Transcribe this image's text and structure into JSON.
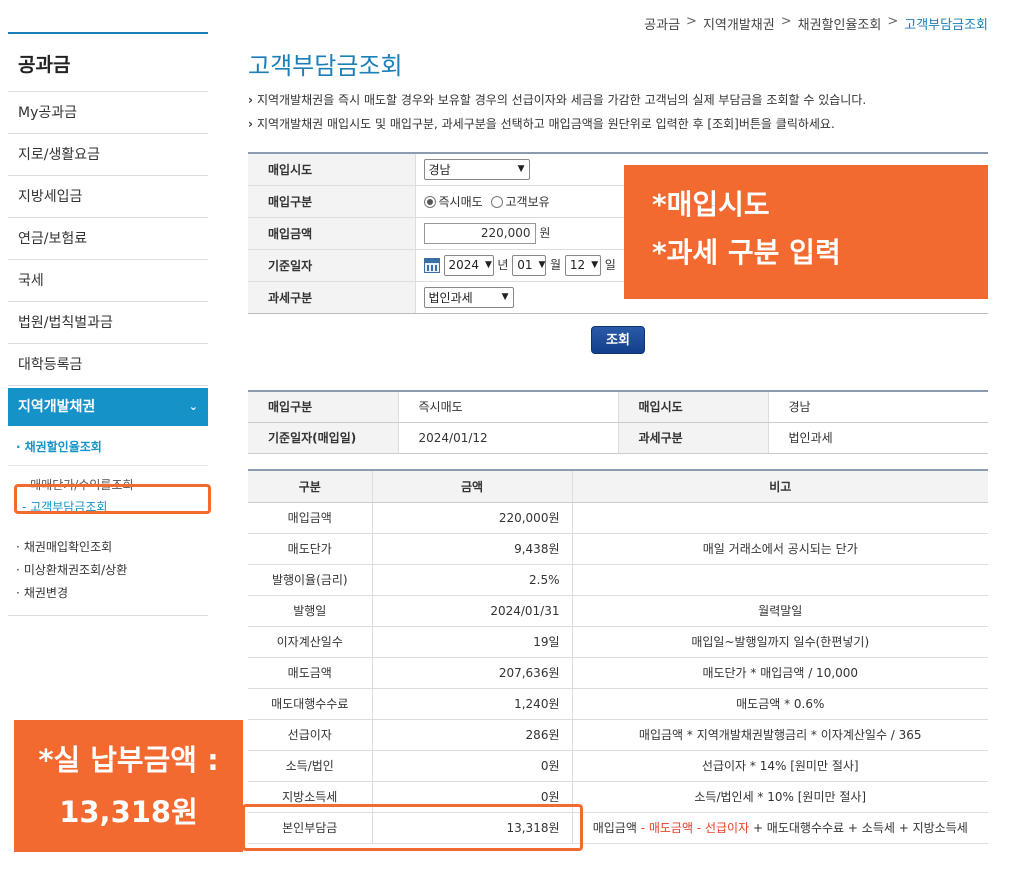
{
  "breadcrumb": [
    "공과금",
    "지역개발채권",
    "채권할인율조회",
    "고객부담금조회"
  ],
  "sidebar": {
    "title": "공과금",
    "items": [
      "My공과금",
      "지로/생활요금",
      "지방세입금",
      "연금/보험료",
      "국세",
      "법원/법칙벌과금",
      "대학등록금"
    ],
    "active": "지역개발채권",
    "sub_title": "채권할인율조회",
    "sub_items": [
      "- 매매단가/수익률조회",
      "- 고객부담금조회"
    ],
    "lower_items": [
      "채권매입확인조회",
      "미상환채권조회/상환",
      "채권변경"
    ]
  },
  "page": {
    "title": "고객부담금조회",
    "desc1": "지역개발채권을 즉시 매도할 경우와 보유할 경우의 선급이자와 세금을 가감한 고객님의 실제 부담금을 조회할 수 있습니다.",
    "desc2": "지역개발채권 매입시도 및 매입구분, 과세구분을 선택하고 매입금액을 원단위로 입력한 후 [조회]버튼을 클릭하세요."
  },
  "form": {
    "region_label": "매입시도",
    "region_value": "경남",
    "type_label": "매입구분",
    "type_opt1": "즉시매도",
    "type_opt2": "고객보유",
    "amount_label": "매입금액",
    "amount_value": "220,000",
    "amount_unit": "원",
    "date_label": "기준일자",
    "year": "2024",
    "year_unit": "년",
    "month": "01",
    "month_unit": "월",
    "day": "12",
    "day_unit": "일",
    "tax_label": "과세구분",
    "tax_value": "법인과세",
    "search_button": "조회"
  },
  "annotations": {
    "box1_line1": "*매입시도",
    "box1_line2": "*과세 구분 입력",
    "box2_line1": "*실 납부금액 :",
    "box2_line2": "13,318원"
  },
  "summary": {
    "type_label": "매입구분",
    "type_value": "즉시매도",
    "region_label": "매입시도",
    "region_value": "경남",
    "date_label": "기준일자(매입일)",
    "date_value": "2024/01/12",
    "tax_label": "과세구분",
    "tax_value": "법인과세"
  },
  "result": {
    "headers": [
      "구분",
      "금액",
      "비고"
    ],
    "rows": [
      {
        "name": "매입금액",
        "amount": "220,000원",
        "note": ""
      },
      {
        "name": "매도단가",
        "amount": "9,438원",
        "note": "매일 거래소에서 공시되는 단가"
      },
      {
        "name": "발행이율(금리)",
        "amount": "2.5%",
        "note": ""
      },
      {
        "name": "발행일",
        "amount": "2024/01/31",
        "note": "월력말일"
      },
      {
        "name": "이자계산일수",
        "amount": "19일",
        "note": "매입일~발행일까지 일수(한편넣기)"
      },
      {
        "name": "매도금액",
        "amount": "207,636원",
        "note": "매도단가 * 매입금액 / 10,000"
      },
      {
        "name": "매도대행수수료",
        "amount": "1,240원",
        "note": "매도금액 * 0.6%"
      },
      {
        "name": "선급이자",
        "amount": "286원",
        "note": "매입금액 * 지역개발채권발행금리 * 이자계산일수 / 365"
      },
      {
        "name": "소득/법인",
        "amount": "0원",
        "note": "선급이자 * 14% [원미만 절사]"
      },
      {
        "name": "지방소득세",
        "amount": "0원",
        "note": "소득/법인세 * 10% [원미만 절사]"
      }
    ],
    "last_row": {
      "name": "본인부담금",
      "amount": "13,318원",
      "note_a": "매입금액 ",
      "note_red": "- 매도금액 - 선급이자",
      "note_b": " + 매도대행수수료 + 소득세 + 지방소득세"
    }
  }
}
